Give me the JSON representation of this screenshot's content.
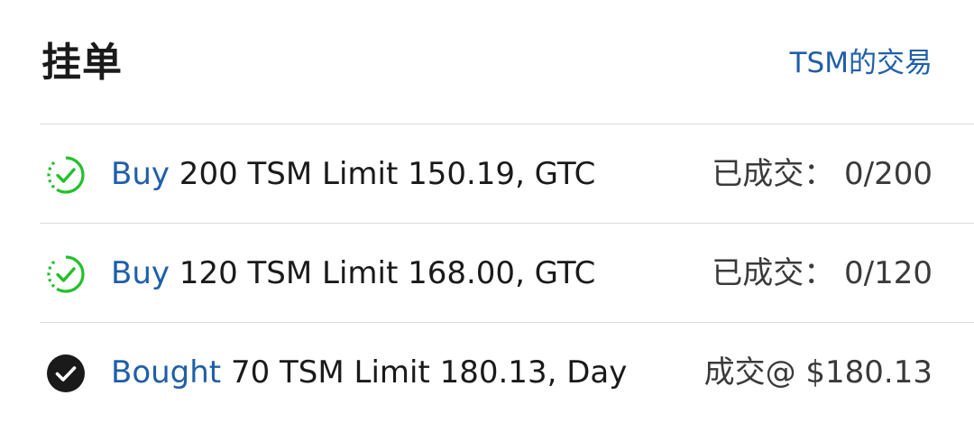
{
  "header": {
    "title": "挂单",
    "link_label": "TSM的交易"
  },
  "orders": [
    {
      "status_icon": "pending-check-icon",
      "action": "Buy",
      "details": " 200 TSM Limit 150.19, GTC",
      "status": "已成交： 0/200"
    },
    {
      "status_icon": "pending-check-icon",
      "action": "Buy",
      "details": " 120 TSM Limit 168.00, GTC",
      "status": "已成交： 0/120"
    },
    {
      "status_icon": "filled-check-icon",
      "action": "Bought",
      "details": " 70 TSM Limit 180.13, Day",
      "status": "成交@ $180.13"
    }
  ],
  "colors": {
    "link": "#1f5fa8",
    "pending_icon": "#22c12a",
    "filled_icon": "#1a1a1a",
    "divider": "#dcdcdc"
  }
}
